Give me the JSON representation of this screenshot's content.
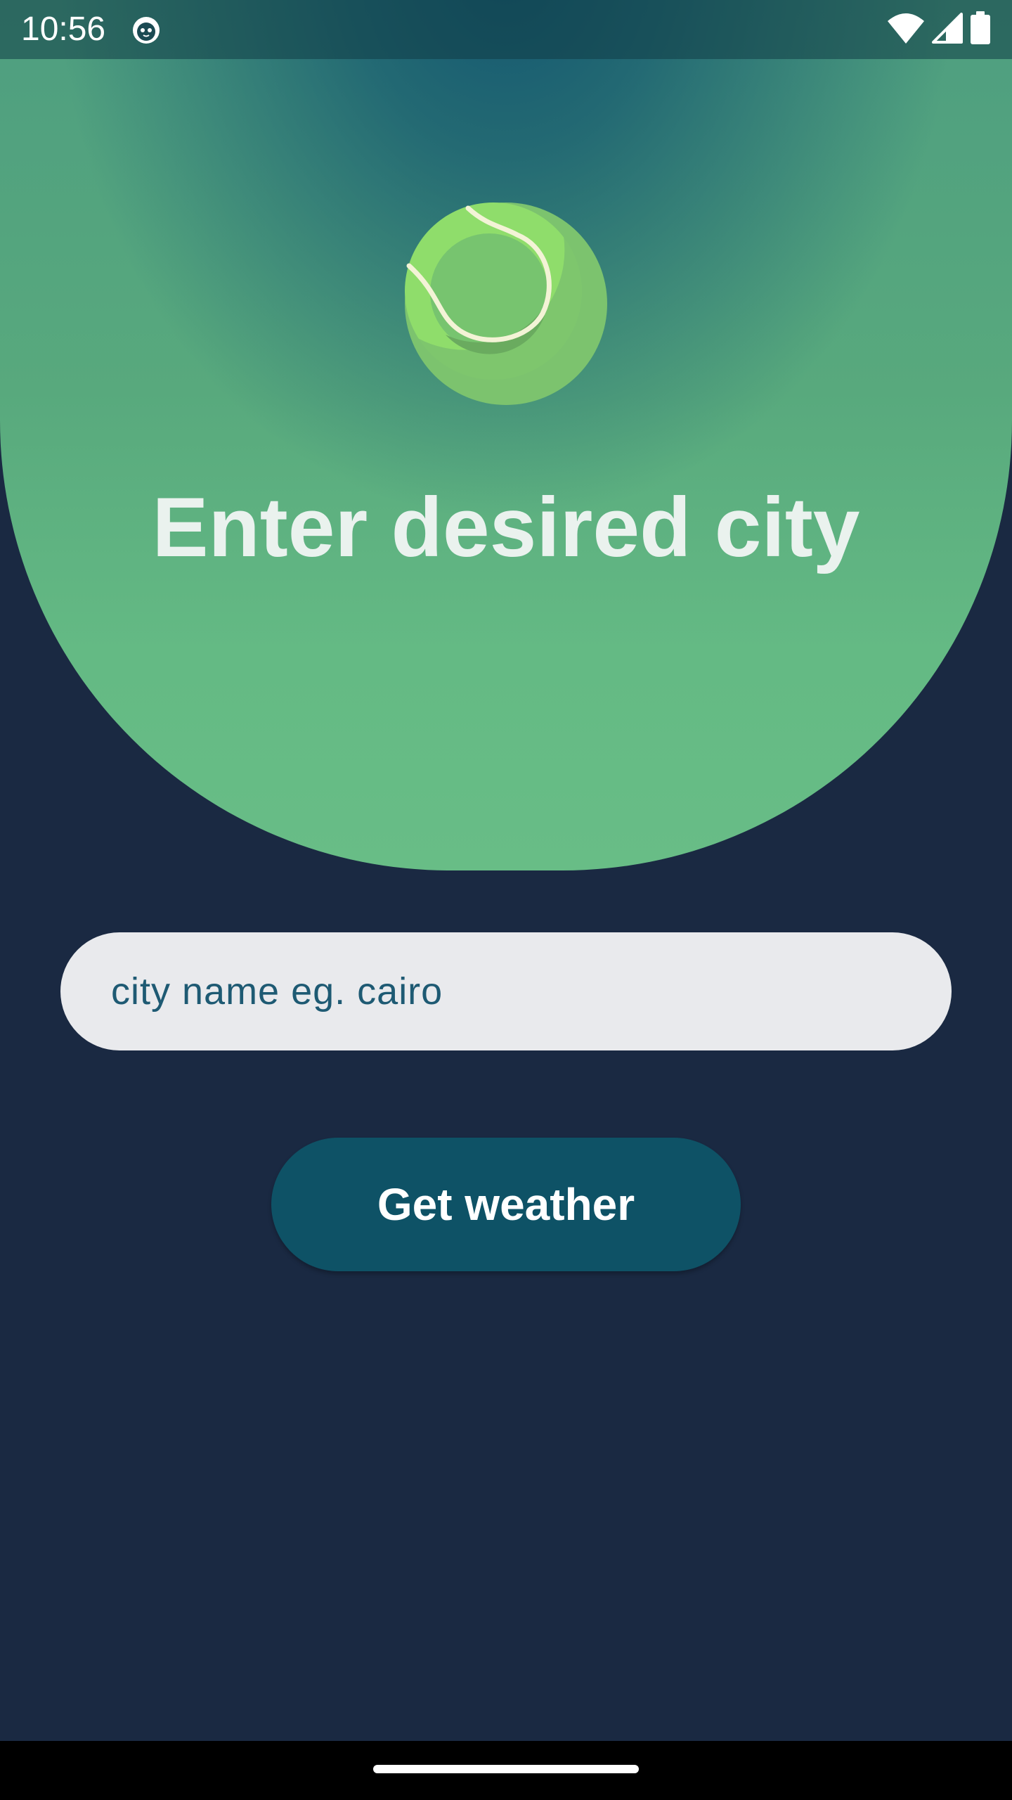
{
  "status_bar": {
    "time": "10:56",
    "icons": [
      "cat-app-icon",
      "wifi-icon",
      "signal-icon",
      "battery-icon"
    ]
  },
  "hero": {
    "logo_icon": "tennis-ball-icon",
    "title": "Enter desired city"
  },
  "form": {
    "city_placeholder": "city name eg. cairo",
    "city_value": "",
    "submit_label": "Get weather"
  },
  "colors": {
    "background": "#1a2942",
    "hero_green": "#68bd86",
    "hero_teal": "#10526e",
    "input_bg": "#e9eaed",
    "input_text": "#1e5a73",
    "button_bg": "#0e5266",
    "title_text": "#eaf2ee"
  }
}
